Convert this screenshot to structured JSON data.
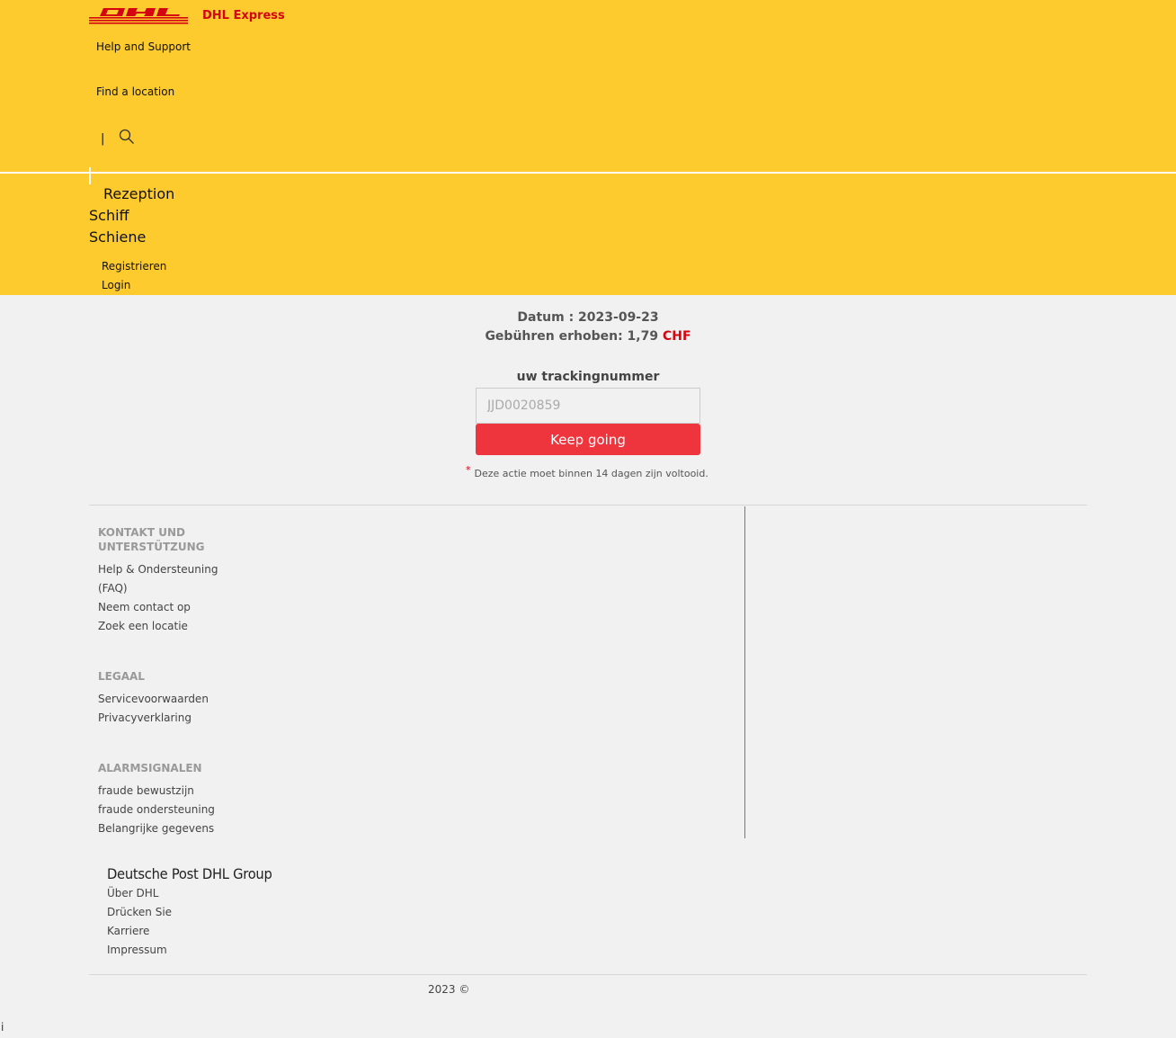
{
  "header": {
    "brand": "DHL Express",
    "top_links": [
      "Help and Support",
      "Find a location"
    ],
    "pipe": "|",
    "nav": [
      "Rezeption",
      "Schiff",
      "Schiene"
    ],
    "auth": [
      "Registrieren",
      "Login"
    ],
    "logo_color": "#d40511",
    "background": "#fecb2f"
  },
  "main": {
    "date_line": "Datum : 2023-09-23",
    "fee_prefix": "Gebühren erhoben: 1,79 ",
    "fee_currency": "CHF",
    "tracking_label": "uw trackingnummer",
    "tracking_placeholder": "JJD0020859",
    "button_label": "Keep going",
    "note_star": "*",
    "note_text": "Deze actie moet binnen 14 dagen zijn voltooid."
  },
  "footer": {
    "contact_heading_1": "KONTAKT UND",
    "contact_heading_2": "UNTERSTÜTZUNG",
    "contact_links": [
      "Help & Ondersteuning",
      "(FAQ)",
      "Neem contact op",
      "Zoek een locatie"
    ],
    "legal_heading": "LEGAAL",
    "legal_links": [
      "Servicevoorwaarden",
      "Privacyverklaring"
    ],
    "alarm_heading": "ALARMSIGNALEN",
    "alarm_links": [
      "fraude bewustzijn",
      "fraude ondersteuning",
      "Belangrijke gegevens"
    ],
    "group_name": "Deutsche Post DHL Group",
    "group_links": [
      "Über DHL",
      "Drücken Sie",
      "Karriere",
      "Impressum"
    ],
    "copyright": "2023 ©",
    "corner": "i"
  },
  "icons": {
    "search": "search-icon",
    "logo": "dhl-logo-icon"
  },
  "colors": {
    "accent_red": "#ee343c",
    "dhl_red": "#d40511",
    "dhl_yellow": "#fecb2f"
  }
}
